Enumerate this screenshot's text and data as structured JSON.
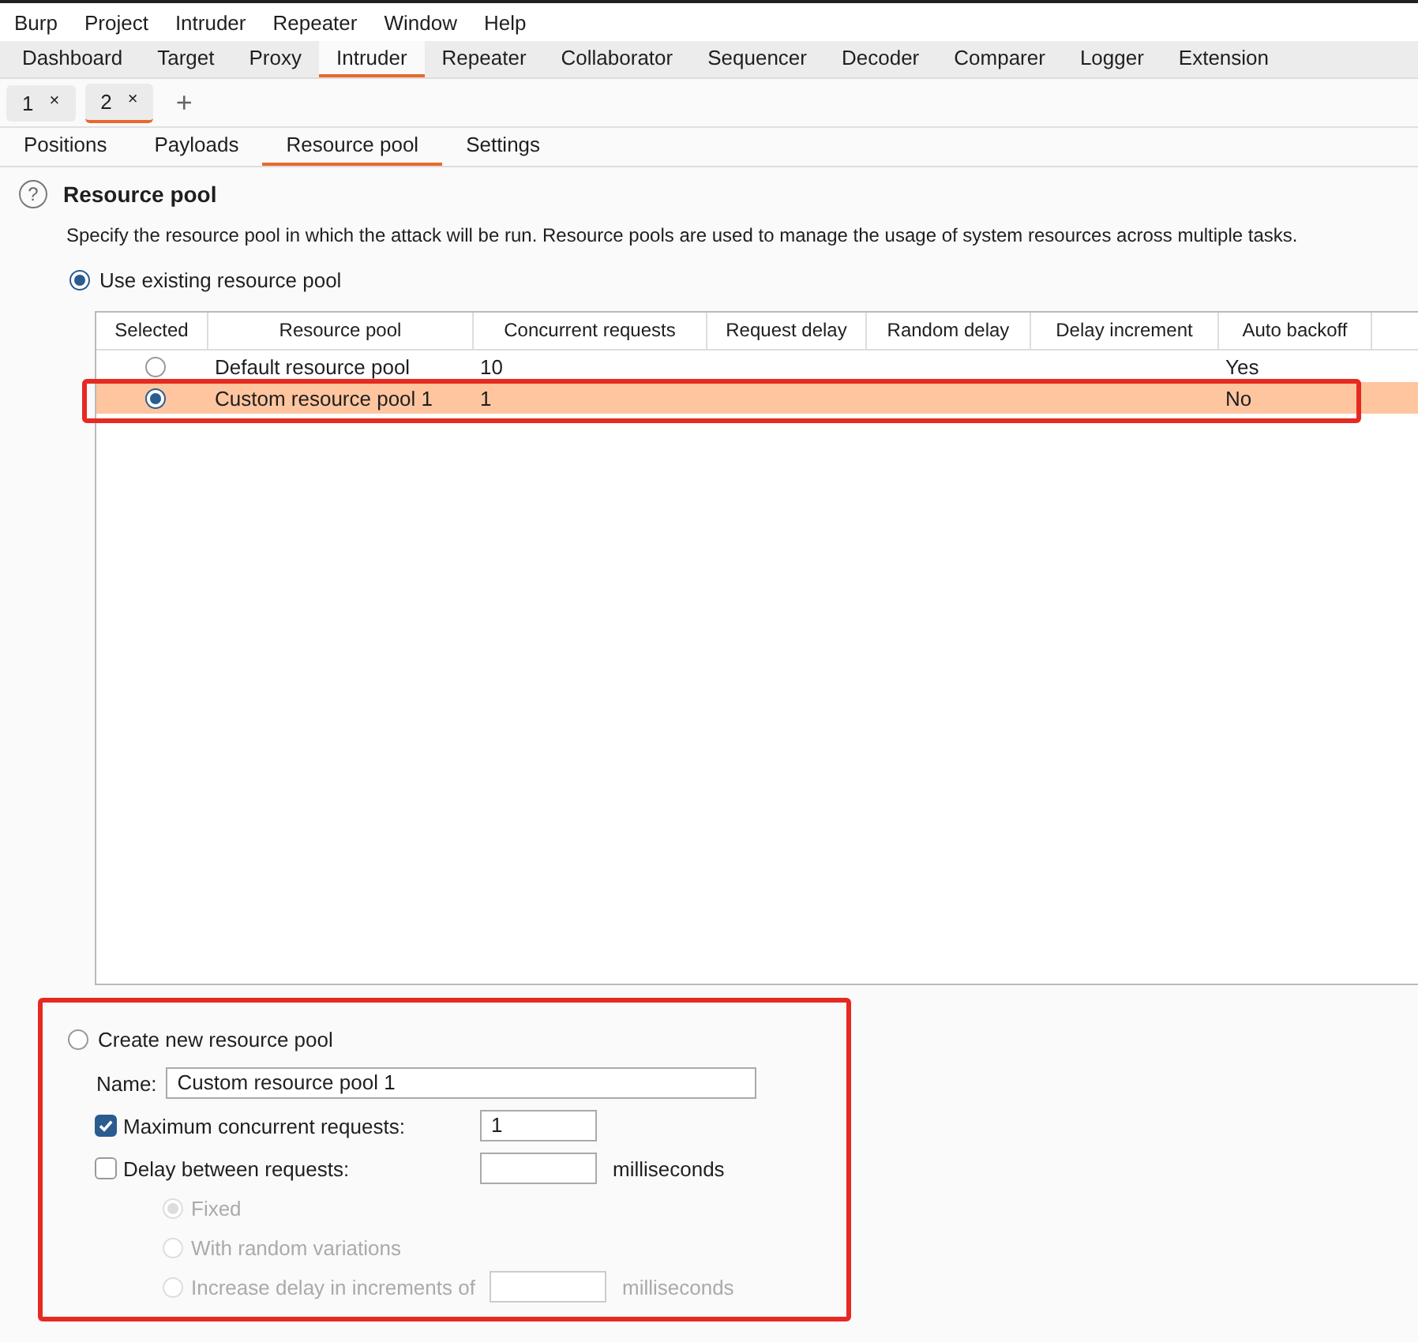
{
  "menu": [
    "Burp",
    "Project",
    "Intruder",
    "Repeater",
    "Window",
    "Help"
  ],
  "tabs": [
    {
      "label": "Dashboard",
      "selected": false
    },
    {
      "label": "Target",
      "selected": false
    },
    {
      "label": "Proxy",
      "selected": false
    },
    {
      "label": "Intruder",
      "selected": true
    },
    {
      "label": "Repeater",
      "selected": false
    },
    {
      "label": "Collaborator",
      "selected": false
    },
    {
      "label": "Sequencer",
      "selected": false
    },
    {
      "label": "Decoder",
      "selected": false
    },
    {
      "label": "Comparer",
      "selected": false
    },
    {
      "label": "Logger",
      "selected": false
    },
    {
      "label": "Extension",
      "selected": false
    }
  ],
  "attack_tabs": [
    {
      "label": "1",
      "close": "×",
      "selected": false
    },
    {
      "label": "2",
      "close": "×",
      "selected": true
    }
  ],
  "add_tab": "+",
  "sub_tabs": [
    {
      "label": "Positions",
      "selected": false
    },
    {
      "label": "Payloads",
      "selected": false
    },
    {
      "label": "Resource pool",
      "selected": true
    },
    {
      "label": "Settings",
      "selected": false
    }
  ],
  "section": {
    "help": "?",
    "title": "Resource pool",
    "description": "Specify the resource pool in which the attack will be run. Resource pools are used to manage the usage of system resources across multiple tasks."
  },
  "use_existing": {
    "label": "Use existing resource pool",
    "selected": true
  },
  "table": {
    "columns": [
      "Selected",
      "Resource pool",
      "Concurrent requests",
      "Request delay",
      "Random delay",
      "Delay increment",
      "Auto backoff"
    ],
    "rows": [
      {
        "selected": false,
        "pool": "Default resource pool",
        "concurrent": "10",
        "auto_backoff": "Yes"
      },
      {
        "selected": true,
        "pool": "Custom resource pool 1",
        "concurrent": "1",
        "auto_backoff": "No"
      }
    ]
  },
  "create_new": {
    "label": "Create new resource pool",
    "selected": false
  },
  "name_field": {
    "label": "Name:",
    "value": "Custom resource pool 1"
  },
  "options": [
    {
      "label": "Maximum concurrent requests:",
      "checked": true,
      "value": "1"
    },
    {
      "label": "Delay between requests:",
      "checked": false,
      "unit": "milliseconds"
    }
  ],
  "delay_modes": [
    {
      "label": "Fixed",
      "selected": true,
      "disabled": true
    },
    {
      "label": "With random variations",
      "selected": false,
      "disabled": true
    },
    {
      "label": "Increase delay in increments of",
      "selected": false,
      "disabled": true,
      "unit": "milliseconds"
    }
  ]
}
